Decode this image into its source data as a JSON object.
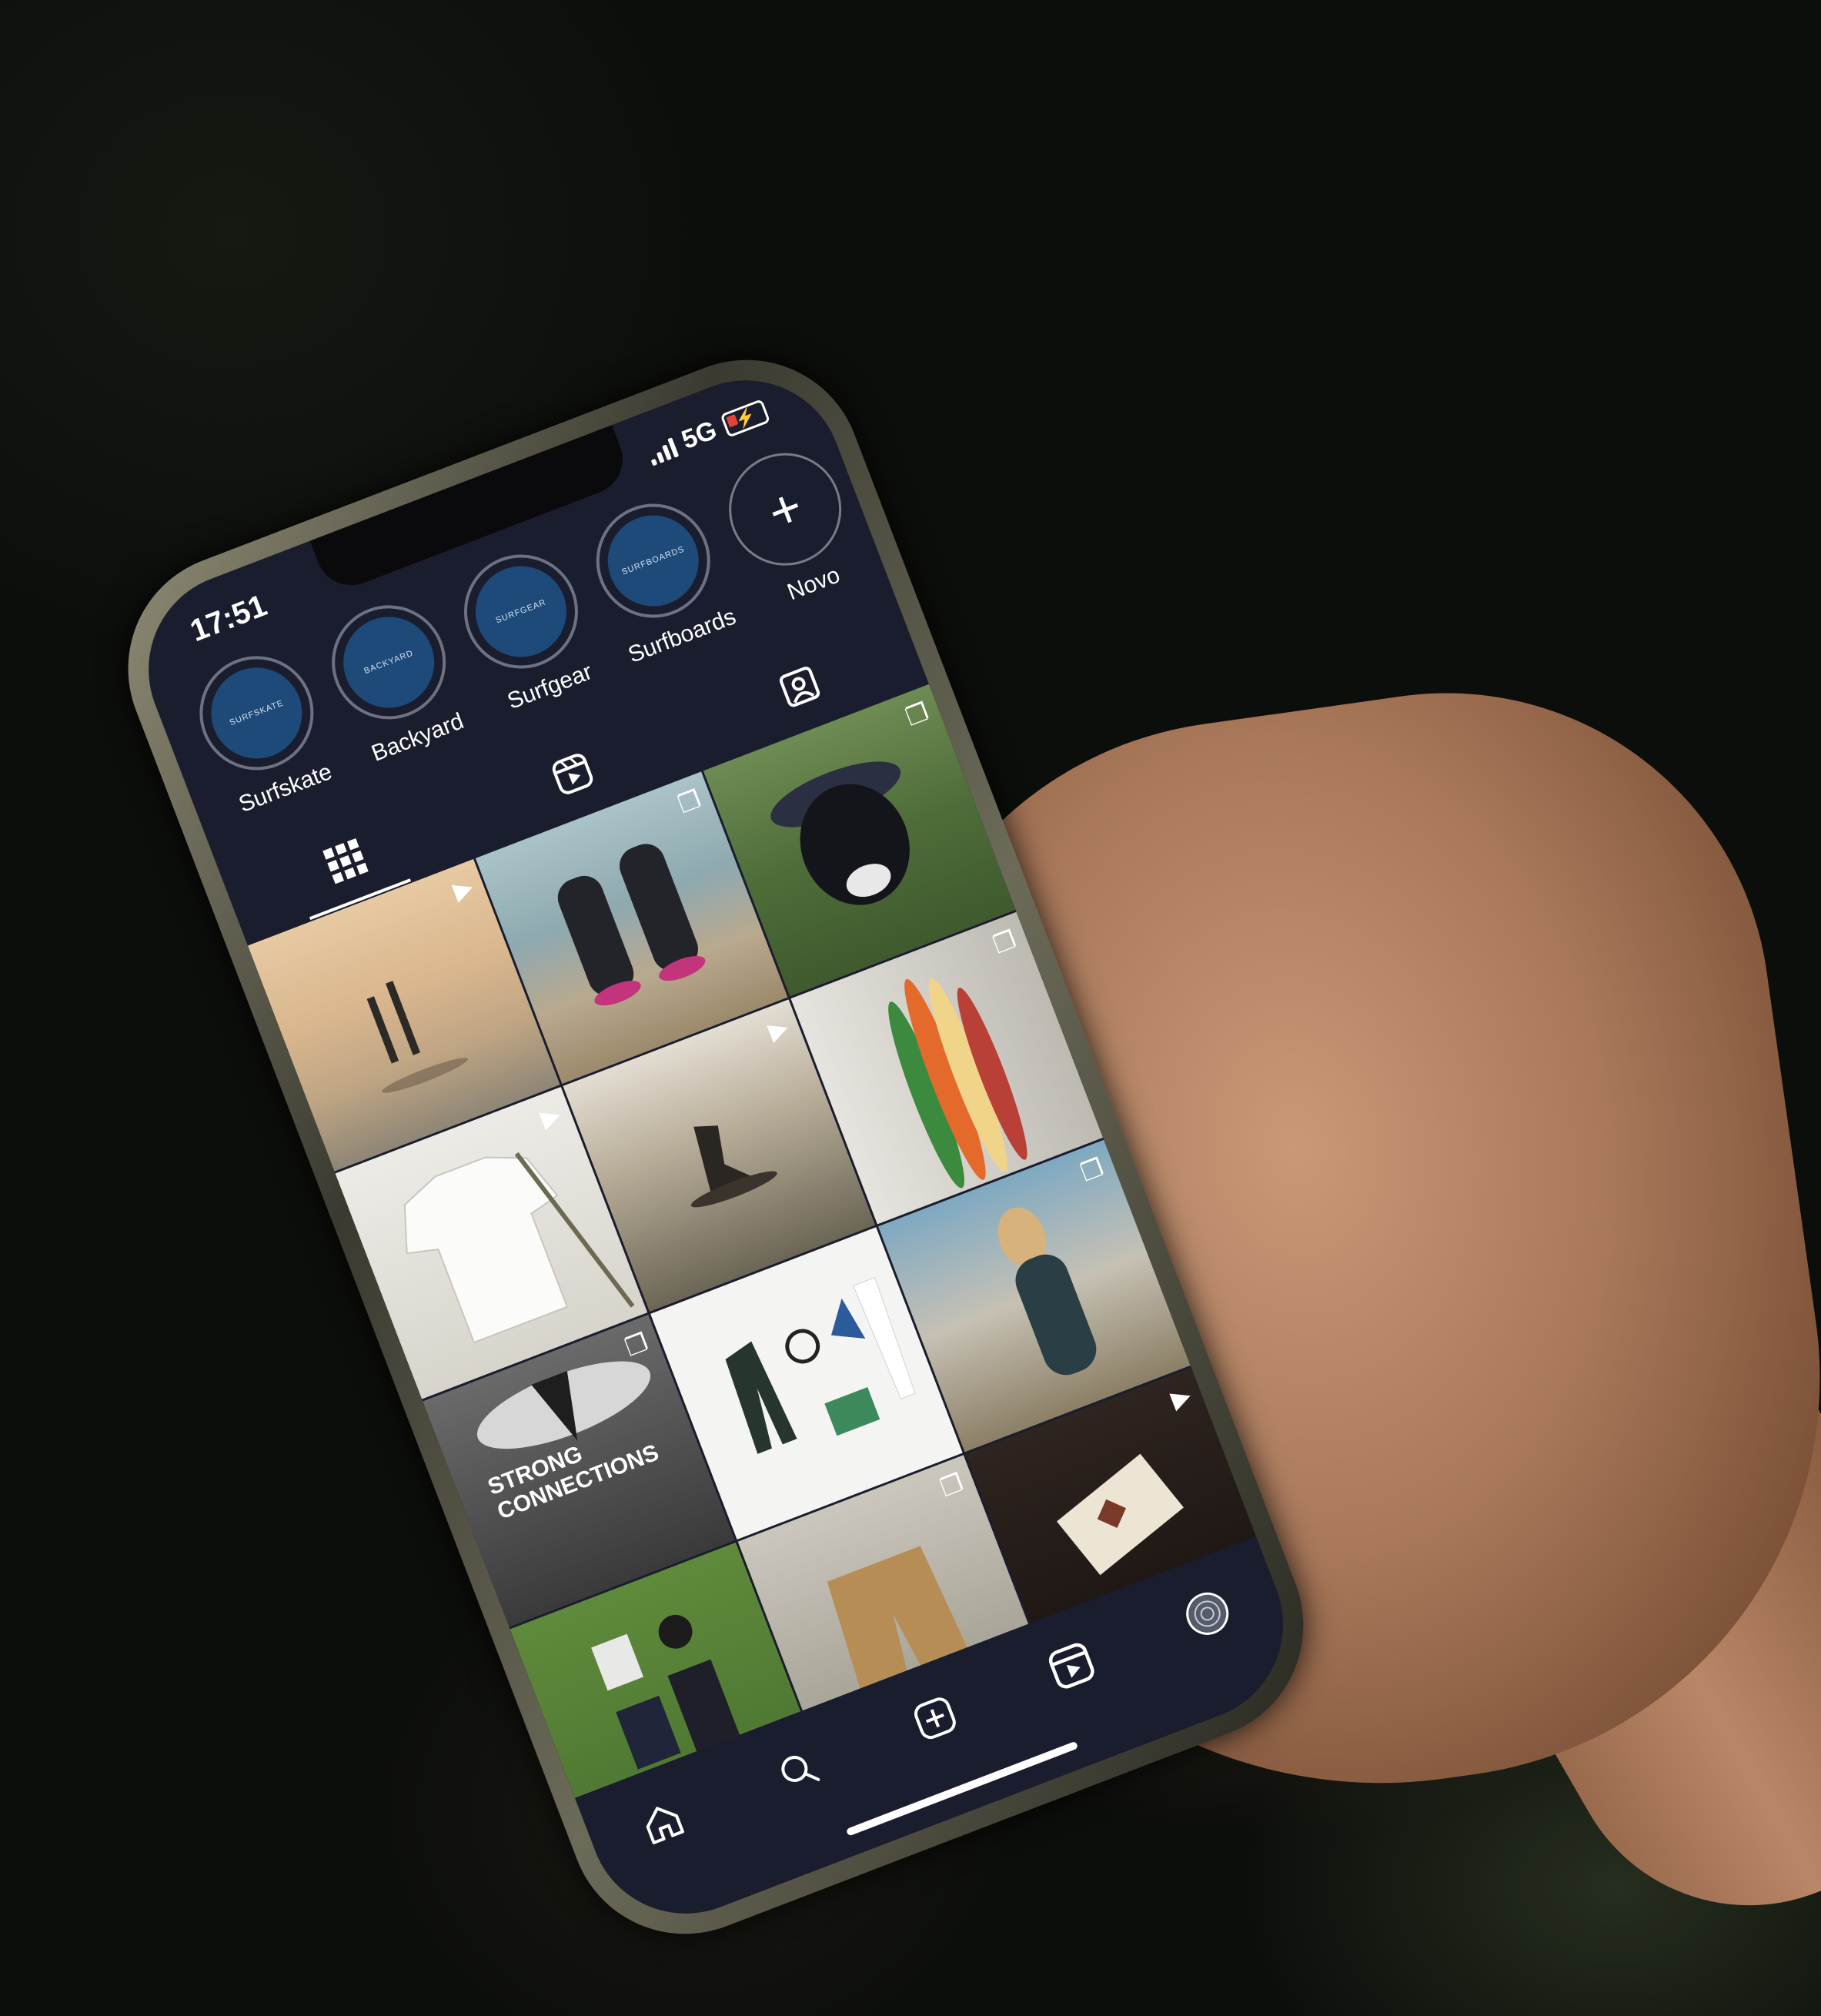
{
  "status_bar": {
    "time": "17:51",
    "network": "5G"
  },
  "highlights": [
    {
      "label": "Surfskate",
      "cover_text": "SURFSKATE"
    },
    {
      "label": "Backyard",
      "cover_text": "BACKYARD"
    },
    {
      "label": "Surfgear",
      "cover_text": "SURFGEAR"
    },
    {
      "label": "Surfboards",
      "cover_text": "SURFBOARDS"
    },
    {
      "label": "Novo",
      "icon": "plus-icon"
    }
  ],
  "profile_tabs": [
    {
      "icon": "grid-icon",
      "active": true
    },
    {
      "icon": "reels-icon",
      "active": false
    },
    {
      "icon": "tagged-icon",
      "active": false
    }
  ],
  "posts": [
    {
      "subject": "surfers-on-beach",
      "badge": "reels-icon"
    },
    {
      "subject": "surf-booties",
      "badge": "carousel-icon"
    },
    {
      "subject": "dog-in-hat",
      "badge": "carousel-icon"
    },
    {
      "subject": "t-shirt",
      "badge": "reels-icon"
    },
    {
      "subject": "surfer-riding",
      "badge": "reels-icon"
    },
    {
      "subject": "surfboards-leaning",
      "badge": "carousel-icon"
    },
    {
      "subject": "surfboard-text",
      "badge": "carousel-icon",
      "caption": "STRONG\nCONNECTIONS"
    },
    {
      "subject": "wetsuit-and-fins",
      "badge": ""
    },
    {
      "subject": "woman-in-wetsuit",
      "badge": "carousel-icon"
    },
    {
      "subject": "gear-flatlay",
      "badge": ""
    },
    {
      "subject": "shorts",
      "badge": "carousel-icon"
    },
    {
      "subject": "patch-on-fabric",
      "badge": "reels-icon"
    }
  ],
  "bottom_nav": [
    {
      "icon": "home-icon"
    },
    {
      "icon": "search-icon"
    },
    {
      "icon": "new-post-icon"
    },
    {
      "icon": "reels-icon"
    },
    {
      "icon": "profile-avatar"
    }
  ],
  "colors": {
    "screen_bg": "#1a1d2e",
    "highlight_fill": "#1d4a78",
    "battery_low": "#e2433a"
  }
}
